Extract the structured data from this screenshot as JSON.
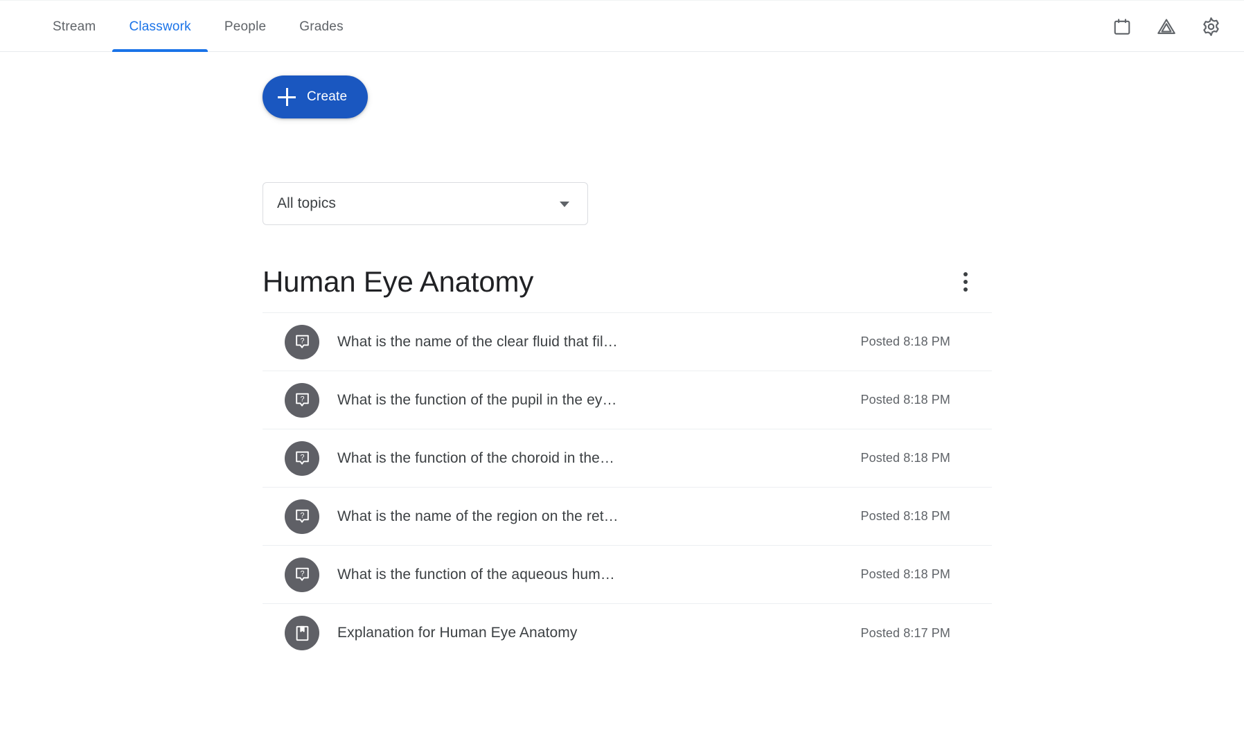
{
  "topbar": {
    "tabs": [
      {
        "label": "Stream",
        "active": false
      },
      {
        "label": "Classwork",
        "active": true
      },
      {
        "label": "People",
        "active": false
      },
      {
        "label": "Grades",
        "active": false
      }
    ],
    "actions": [
      {
        "name": "calendar-icon",
        "title": "Calendar"
      },
      {
        "name": "drive-icon",
        "title": "Class Drive folder"
      },
      {
        "name": "gear-icon",
        "title": "Settings"
      }
    ],
    "accent_color": "#1a73e8"
  },
  "toolbar": {
    "create_label": "Create",
    "create_icon": "plus-icon",
    "create_color": "#1a57c0",
    "topics_filter_value": "All topics",
    "topics_filter_caret": "chevron-down-icon"
  },
  "topic": {
    "title": "Human Eye Anatomy",
    "menu_icon": "more-vert-icon",
    "items": [
      {
        "title": "What is the name of the clear fluid that fil…",
        "meta": "Posted 8:18 PM",
        "icon": "question-icon"
      },
      {
        "title": "What is the function of the pupil in the ey…",
        "meta": "Posted 8:18 PM",
        "icon": "question-icon"
      },
      {
        "title": "What is the function of the choroid in the…",
        "meta": "Posted 8:18 PM",
        "icon": "question-icon"
      },
      {
        "title": "What is the name of the region on the ret…",
        "meta": "Posted 8:18 PM",
        "icon": "question-icon"
      },
      {
        "title": "What is the function of the aqueous hum…",
        "meta": "Posted 8:18 PM",
        "icon": "question-icon"
      },
      {
        "title": "Explanation for Human Eye Anatomy",
        "meta": "Posted 8:17 PM",
        "icon": "material-book-icon"
      }
    ]
  }
}
